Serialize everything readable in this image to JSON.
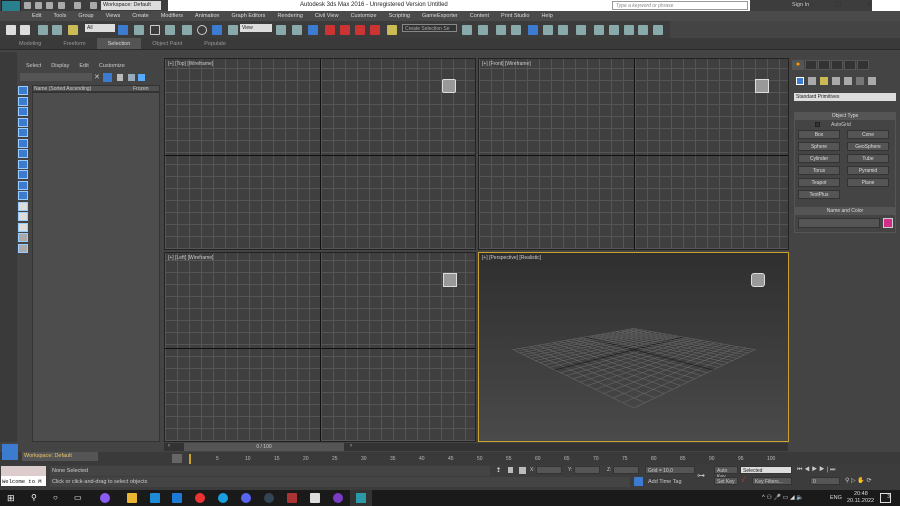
{
  "titlebar": {
    "app_title": "Autodesk 3ds Max 2016 - Unregistered Version   Untitled",
    "workspace": "Workspace: Default",
    "search_placeholder": "Type a keyword or phrase",
    "sign_in": "Sign In",
    "logo": "MAX"
  },
  "menu": [
    "Edit",
    "Tools",
    "Group",
    "Views",
    "Create",
    "Modifiers",
    "Animation",
    "Graph Editors",
    "Rendering",
    "Civil View",
    "Customize",
    "Scripting",
    "GameExporter",
    "Content",
    "Print Studio",
    "Help"
  ],
  "toolbar": {
    "selection_filter": "All",
    "ref_coord": "View",
    "named_selection": "Create Selection Se"
  },
  "ribbon": {
    "tabs": [
      "Modeling",
      "Freeform",
      "Selection",
      "Object Paint",
      "Populate"
    ],
    "active": "Selection"
  },
  "explorer": {
    "menu": [
      "Select",
      "Display",
      "Edit",
      "Customize"
    ],
    "col_name": "Name (Sorted Ascending)",
    "col_frozen": "Frozen",
    "workspace": "Workspace: Default"
  },
  "viewports": {
    "top": "[+] [Top] [Wireframe]",
    "front": "[+] [Front] [Wireframe]",
    "left": "[+] [Left] [Wireframe]",
    "perspective": "[+] [Perspective] [Realistic]"
  },
  "command_panel": {
    "dropdown": "Standard Primitives",
    "object_type": "Object Type",
    "autogrid": "AutoGrid",
    "buttons": [
      "Box",
      "Cone",
      "Sphere",
      "GeoSphere",
      "Cylinder",
      "Tube",
      "Torus",
      "Pyramid",
      "Teapot",
      "Plane",
      "TextPlus"
    ],
    "name_color": "Name and Color",
    "color": "#d12e8a"
  },
  "timeline": {
    "slider": "0 / 100",
    "ticks": [
      "5",
      "10",
      "15",
      "20",
      "25",
      "30",
      "35",
      "40",
      "45",
      "50",
      "55",
      "60",
      "65",
      "70",
      "75",
      "80",
      "85",
      "90",
      "95",
      "100"
    ]
  },
  "status": {
    "listener": "Welcome to M",
    "selection": "None Selected",
    "prompt": "Click or click-and-drag to select objects",
    "x_label": "X:",
    "y_label": "Y:",
    "z_label": "Z:",
    "grid": "Grid = 10,0",
    "add_time_tag": "Add Time Tag",
    "auto_key": "Auto Key",
    "auto_key_mode": "Selected",
    "set_key": "Set Key",
    "key_filters": "Key Filters...",
    "frame": "0"
  },
  "taskbar": {
    "lang": "ENG",
    "time": "20:48",
    "date": "20.11.2022",
    "notifications": "3"
  }
}
